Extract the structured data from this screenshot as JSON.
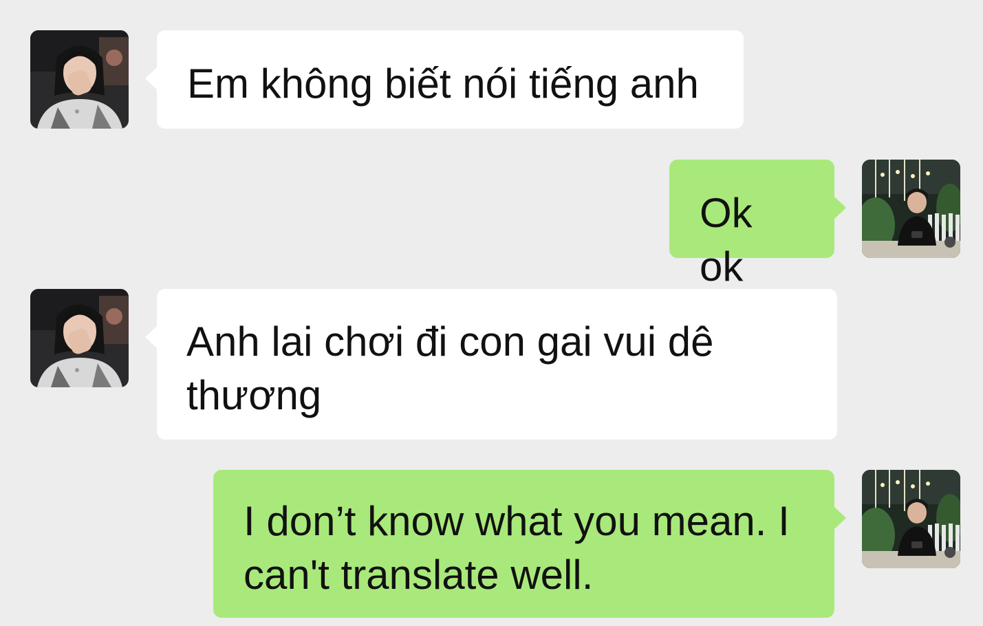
{
  "chat": {
    "messages": [
      {
        "sender": "contact",
        "text": "Em không biết nói tiếng anh"
      },
      {
        "sender": "me",
        "text": "Ok ok"
      },
      {
        "sender": "contact",
        "text": "Anh lai chơi đi con gai vui dê thương"
      },
      {
        "sender": "me",
        "text": "I don’t know what you mean. I can't translate well."
      }
    ]
  },
  "colors": {
    "background": "#ededed",
    "incoming_bubble": "#ffffff",
    "outgoing_bubble": "#a9e97b",
    "text": "#111111"
  },
  "icons": {
    "contact_avatar": "contact-avatar-photo",
    "my_avatar": "my-avatar-photo"
  }
}
